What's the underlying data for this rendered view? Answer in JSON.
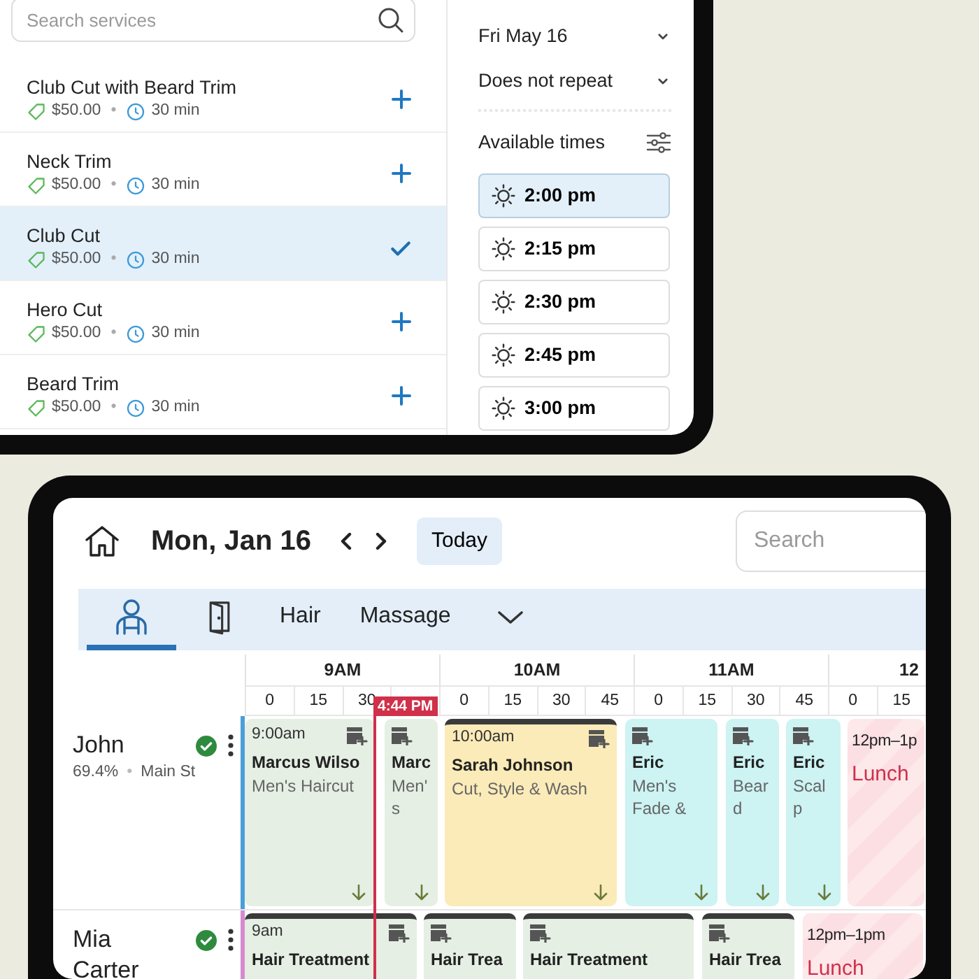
{
  "services_panel": {
    "search": {
      "placeholder": "Search services"
    },
    "services": [
      {
        "name": "Club Cut with Beard Trim",
        "price": "$50.00",
        "separator": "•",
        "duration": "30 min",
        "selected": false
      },
      {
        "name": "Neck Trim",
        "price": "$50.00",
        "separator": "•",
        "duration": "30 min",
        "selected": false
      },
      {
        "name": "Club Cut",
        "price": "$50.00",
        "separator": "•",
        "duration": "30 min",
        "selected": true
      },
      {
        "name": "Hero Cut",
        "price": "$50.00",
        "separator": "•",
        "duration": "30 min",
        "selected": false
      },
      {
        "name": "Beard Trim",
        "price": "$50.00",
        "separator": "•",
        "duration": "30 min",
        "selected": false
      }
    ]
  },
  "booking_panel": {
    "date": "Fri May 16",
    "repeat": "Does not repeat",
    "times_heading": "Available times",
    "times": [
      {
        "label": "2:00 pm",
        "selected": true
      },
      {
        "label": "2:15 pm",
        "selected": false
      },
      {
        "label": "2:30 pm",
        "selected": false
      },
      {
        "label": "2:45 pm",
        "selected": false
      },
      {
        "label": "3:00 pm",
        "selected": false
      }
    ]
  },
  "calendar": {
    "date": "Mon, Jan 16",
    "today_button": "Today",
    "search": {
      "placeholder": "Search"
    },
    "tabs": [
      {
        "kind": "staff",
        "selected": true
      },
      {
        "kind": "rooms",
        "selected": false
      },
      {
        "kind": "text",
        "label": "Hair",
        "selected": false
      },
      {
        "kind": "text",
        "label": "Massage",
        "selected": false
      },
      {
        "kind": "more",
        "selected": false
      }
    ],
    "hours": [
      {
        "label": "9AM",
        "quarters": [
          "0",
          "15",
          "30"
        ]
      },
      {
        "label": "10AM",
        "quarters": [
          "0",
          "15",
          "30",
          "45"
        ]
      },
      {
        "label": "11AM",
        "quarters": [
          "0",
          "15",
          "30",
          "45"
        ]
      },
      {
        "label": "12",
        "quarters": [
          "0",
          "15"
        ]
      }
    ],
    "now": {
      "label": "4:44 PM"
    },
    "staff": [
      {
        "name": "John",
        "utilization": "69.4%",
        "separator": "•",
        "location": "Main St",
        "color": "#4a9fd8",
        "events": [
          {
            "kind": "appointment",
            "color": "#e5efe4",
            "confirmed": false,
            "arrow": true,
            "time": "9:00am",
            "title": "Marcus Wilso",
            "service": "Men's Haircut"
          },
          {
            "kind": "appointment",
            "color": "#e5efe4",
            "confirmed": false,
            "arrow": true,
            "title": "Marc",
            "service": "Men's"
          },
          {
            "kind": "appointment",
            "color": "#fbebb8",
            "confirmed": true,
            "arrow": true,
            "time": "10:00am",
            "title": "Sarah Johnson",
            "service": "Cut, Style & Wash"
          },
          {
            "kind": "appointment",
            "color": "#cdf3f3",
            "confirmed": false,
            "arrow": true,
            "title": "Eric",
            "service": "Men's Fade &"
          },
          {
            "kind": "appointment",
            "color": "#cdf3f3",
            "confirmed": false,
            "arrow": true,
            "title": "Eric",
            "service": "Beard"
          },
          {
            "kind": "appointment",
            "color": "#cdf3f3",
            "confirmed": false,
            "arrow": true,
            "title": "Eric",
            "service": "Scalp"
          },
          {
            "kind": "break",
            "time": "12pm–1p",
            "title": "Lunch"
          }
        ]
      },
      {
        "name": "Mia Carter",
        "color": "#d68bcf",
        "events": [
          {
            "kind": "appointment",
            "color": "#e5efe4",
            "confirmed": true,
            "time": "9am",
            "title": "Hair Treatment"
          },
          {
            "kind": "appointment",
            "color": "#e5efe4",
            "confirmed": true,
            "title": "Hair Trea"
          },
          {
            "kind": "appointment",
            "color": "#e5efe4",
            "confirmed": true,
            "title": "Hair Treatment"
          },
          {
            "kind": "appointment",
            "color": "#e5efe4",
            "confirmed": true,
            "title": "Hair Trea"
          },
          {
            "kind": "break",
            "time": "12pm–1pm",
            "title": "Lunch"
          }
        ]
      }
    ]
  }
}
